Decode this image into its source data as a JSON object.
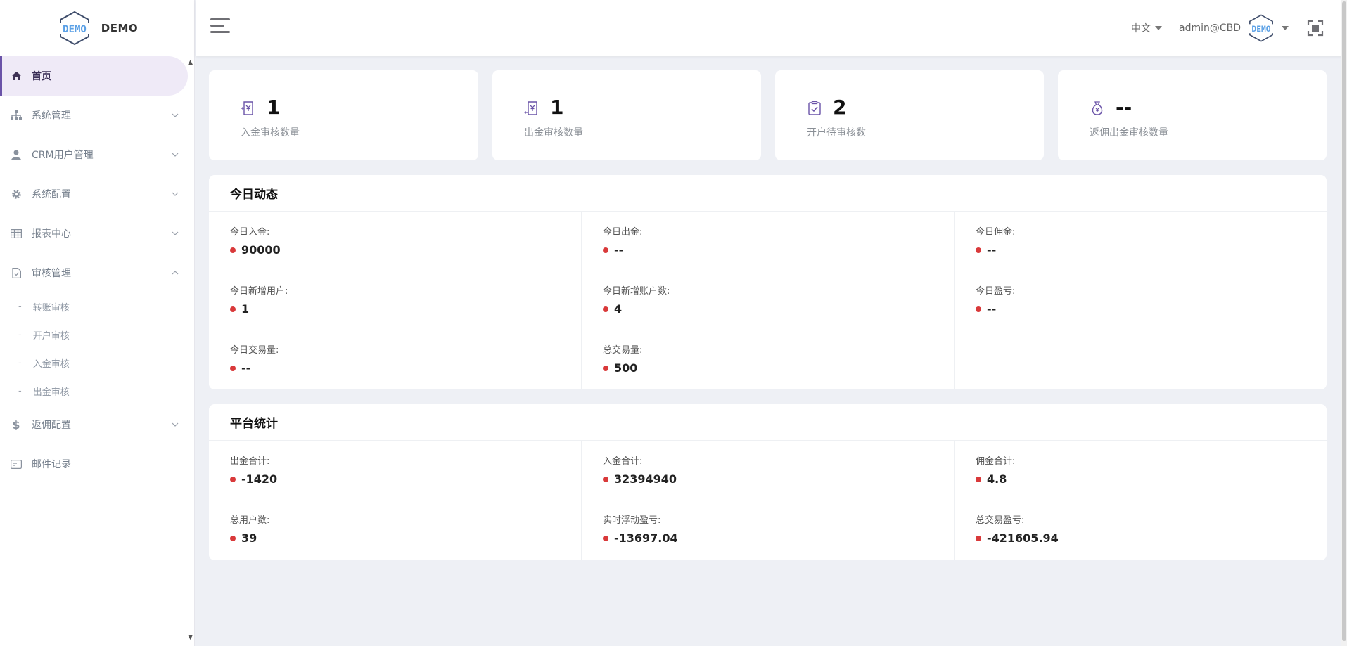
{
  "brand": {
    "logo_text": "DEMO",
    "name": "DEMO"
  },
  "colors": {
    "accent": "#6a53a8",
    "dot": "#d9393a",
    "logo_blue": "#5aa0e6"
  },
  "sidebar": {
    "items": [
      {
        "label": "首页",
        "icon": "home-icon",
        "active": true
      },
      {
        "label": "系统管理",
        "icon": "sitemap-icon"
      },
      {
        "label": "CRM用户管理",
        "icon": "user-icon"
      },
      {
        "label": "系统配置",
        "icon": "gear-icon"
      },
      {
        "label": "报表中心",
        "icon": "table-icon"
      },
      {
        "label": "审核管理",
        "icon": "audit-icon",
        "expanded": true
      },
      {
        "label": "返佣配置",
        "icon": "dollar-icon"
      },
      {
        "label": "邮件记录",
        "icon": "mail-record-icon"
      }
    ],
    "audit_sub": [
      {
        "label": "转账审核"
      },
      {
        "label": "开户审核"
      },
      {
        "label": "入金审核"
      },
      {
        "label": "出金审核"
      }
    ]
  },
  "header": {
    "language": "中文",
    "user": "admin@CBD"
  },
  "cards": [
    {
      "value": "1",
      "label": "入金审核数量",
      "icon": "deposit-receipt-icon"
    },
    {
      "value": "1",
      "label": "出金审核数量",
      "icon": "withdraw-receipt-icon"
    },
    {
      "value": "2",
      "label": "开户待审核数",
      "icon": "clipboard-check-icon"
    },
    {
      "value": "--",
      "label": "返佣出金审核数量",
      "icon": "money-bag-icon"
    }
  ],
  "today": {
    "title": "今日动态",
    "col1": [
      {
        "label": "今日入金:",
        "value": "90000"
      },
      {
        "label": "今日新增用户:",
        "value": "1"
      },
      {
        "label": "今日交易量:",
        "value": "--"
      }
    ],
    "col2": [
      {
        "label": "今日出金:",
        "value": "--"
      },
      {
        "label": "今日新增账户数:",
        "value": "4"
      },
      {
        "label": "总交易量:",
        "value": "500"
      }
    ],
    "col3": [
      {
        "label": "今日佣金:",
        "value": "--"
      },
      {
        "label": "今日盈亏:",
        "value": "--"
      }
    ]
  },
  "platform": {
    "title": "平台统计",
    "col1": [
      {
        "label": "出金合计:",
        "value": "-1420"
      },
      {
        "label": "总用户数:",
        "value": "39"
      }
    ],
    "col2": [
      {
        "label": "入金合计:",
        "value": "32394940"
      },
      {
        "label": "实时浮动盈亏:",
        "value": "-13697.04"
      }
    ],
    "col3": [
      {
        "label": "佣金合计:",
        "value": "4.8"
      },
      {
        "label": "总交易盈亏:",
        "value": "-421605.94"
      }
    ]
  }
}
